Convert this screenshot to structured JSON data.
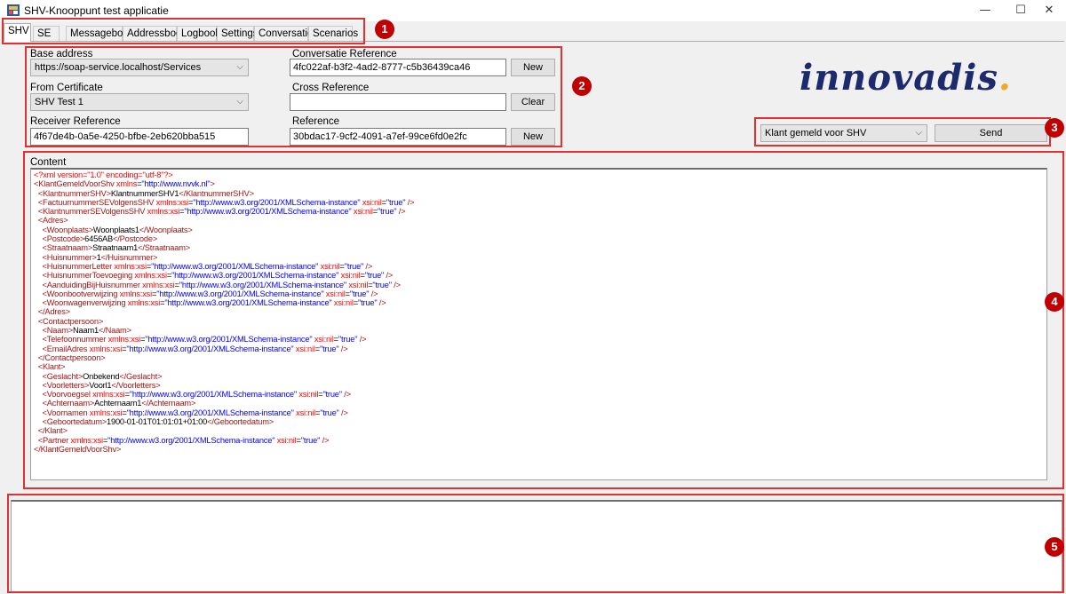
{
  "window": {
    "title": "SHV-Knooppunt test applicatie",
    "minimize": "—",
    "maximize": "☐",
    "close": "✕"
  },
  "tabs": [
    "SHV",
    "SE",
    "Messagebox",
    "Addressbook",
    "Logbook",
    "Settings",
    "Conversation",
    "Scenarios"
  ],
  "form": {
    "base_address_label": "Base address",
    "base_address_value": "https://soap-service.localhost/Services",
    "from_certificate_label": "From Certificate",
    "from_certificate_value": "SHV Test 1",
    "receiver_reference_label": "Receiver Reference",
    "receiver_reference_value": "4f67de4b-0a5e-4250-bfbe-2eb620bba515",
    "conversatie_reference_label": "Conversatie Reference",
    "conversatie_reference_value": "4fc022af-b3f2-4ad2-8777-c5b36439ca46",
    "cross_reference_label": "Cross Reference",
    "cross_reference_value": "",
    "reference_label": "Reference",
    "reference_value": "30bdac17-9cf2-4091-a7ef-99ce6fd0e2fc",
    "new_label": "New",
    "clear_label": "Clear"
  },
  "logo": {
    "text": "innovadis",
    "dot": "."
  },
  "send_panel": {
    "message_type_value": "Klant gemeld voor SHV",
    "send_label": "Send"
  },
  "content": {
    "label": "Content",
    "lines": [
      [
        [
          "a",
          "<?xml version=\"1.0\" encoding=\"utf-8\"?>"
        ]
      ],
      [
        [
          "t",
          "<KlantGemeldVoorShv "
        ],
        [
          "a",
          "xmlns"
        ],
        [
          "x",
          "="
        ],
        [
          "v",
          "\"http://www.nvvk.nl\""
        ],
        [
          "t",
          ">"
        ]
      ],
      [
        [
          "t",
          "  <KlantnummerSHV>"
        ],
        [
          "x",
          "KlantnummerSHV1"
        ],
        [
          "t",
          "</KlantnummerSHV>"
        ]
      ],
      [
        [
          "t",
          "  <FactuurnummerSEVolgensSHV "
        ],
        [
          "a",
          "xmlns:xsi"
        ],
        [
          "x",
          "="
        ],
        [
          "v",
          "\"http://www.w3.org/2001/XMLSchema-instance\""
        ],
        [
          "a",
          " xsi:nil"
        ],
        [
          "x",
          "="
        ],
        [
          "v",
          "\"true\""
        ],
        [
          "t",
          " />"
        ]
      ],
      [
        [
          "t",
          "  <KlantnummerSEVolgensSHV "
        ],
        [
          "a",
          "xmlns:xsi"
        ],
        [
          "x",
          "="
        ],
        [
          "v",
          "\"http://www.w3.org/2001/XMLSchema-instance\""
        ],
        [
          "a",
          " xsi:nil"
        ],
        [
          "x",
          "="
        ],
        [
          "v",
          "\"true\""
        ],
        [
          "t",
          " />"
        ]
      ],
      [
        [
          "t",
          "  <Adres>"
        ]
      ],
      [
        [
          "t",
          "    <Woonplaats>"
        ],
        [
          "x",
          "Woonplaats1"
        ],
        [
          "t",
          "</Woonplaats>"
        ]
      ],
      [
        [
          "t",
          "    <Postcode>"
        ],
        [
          "x",
          "6456AB"
        ],
        [
          "t",
          "</Postcode>"
        ]
      ],
      [
        [
          "t",
          "    <Straatnaam>"
        ],
        [
          "x",
          "Straatnaam1"
        ],
        [
          "t",
          "</Straatnaam>"
        ]
      ],
      [
        [
          "t",
          "    <Huisnummer>"
        ],
        [
          "x",
          "1"
        ],
        [
          "t",
          "</Huisnummer>"
        ]
      ],
      [
        [
          "t",
          "    <HuisnummerLetter "
        ],
        [
          "a",
          "xmlns:xsi"
        ],
        [
          "x",
          "="
        ],
        [
          "v",
          "\"http://www.w3.org/2001/XMLSchema-instance\""
        ],
        [
          "a",
          " xsi:nil"
        ],
        [
          "x",
          "="
        ],
        [
          "v",
          "\"true\""
        ],
        [
          "t",
          " />"
        ]
      ],
      [
        [
          "t",
          "    <HuisnummerToevoeging "
        ],
        [
          "a",
          "xmlns:xsi"
        ],
        [
          "x",
          "="
        ],
        [
          "v",
          "\"http://www.w3.org/2001/XMLSchema-instance\""
        ],
        [
          "a",
          " xsi:nil"
        ],
        [
          "x",
          "="
        ],
        [
          "v",
          "\"true\""
        ],
        [
          "t",
          " />"
        ]
      ],
      [
        [
          "t",
          "    <AanduidingBijHuisnummer "
        ],
        [
          "a",
          "xmlns:xsi"
        ],
        [
          "x",
          "="
        ],
        [
          "v",
          "\"http://www.w3.org/2001/XMLSchema-instance\""
        ],
        [
          "a",
          " xsi:nil"
        ],
        [
          "x",
          "="
        ],
        [
          "v",
          "\"true\""
        ],
        [
          "t",
          " />"
        ]
      ],
      [
        [
          "t",
          "    <Woonbootverwijzing "
        ],
        [
          "a",
          "xmlns:xsi"
        ],
        [
          "x",
          "="
        ],
        [
          "v",
          "\"http://www.w3.org/2001/XMLSchema-instance\""
        ],
        [
          "a",
          " xsi:nil"
        ],
        [
          "x",
          "="
        ],
        [
          "v",
          "\"true\""
        ],
        [
          "t",
          " />"
        ]
      ],
      [
        [
          "t",
          "    <Woonwagenverwijzing "
        ],
        [
          "a",
          "xmlns:xsi"
        ],
        [
          "x",
          "="
        ],
        [
          "v",
          "\"http://www.w3.org/2001/XMLSchema-instance\""
        ],
        [
          "a",
          " xsi:nil"
        ],
        [
          "x",
          "="
        ],
        [
          "v",
          "\"true\""
        ],
        [
          "t",
          " />"
        ]
      ],
      [
        [
          "t",
          "  </Adres>"
        ]
      ],
      [
        [
          "t",
          "  <Contactpersoon>"
        ]
      ],
      [
        [
          "t",
          "    <Naam>"
        ],
        [
          "x",
          "Naam1"
        ],
        [
          "t",
          "</Naam>"
        ]
      ],
      [
        [
          "t",
          "    <Telefoonnummer "
        ],
        [
          "a",
          "xmlns:xsi"
        ],
        [
          "x",
          "="
        ],
        [
          "v",
          "\"http://www.w3.org/2001/XMLSchema-instance\""
        ],
        [
          "a",
          " xsi:nil"
        ],
        [
          "x",
          "="
        ],
        [
          "v",
          "\"true\""
        ],
        [
          "t",
          " />"
        ]
      ],
      [
        [
          "t",
          "    <EmailAdres "
        ],
        [
          "a",
          "xmlns:xsi"
        ],
        [
          "x",
          "="
        ],
        [
          "v",
          "\"http://www.w3.org/2001/XMLSchema-instance\""
        ],
        [
          "a",
          " xsi:nil"
        ],
        [
          "x",
          "="
        ],
        [
          "v",
          "\"true\""
        ],
        [
          "t",
          " />"
        ]
      ],
      [
        [
          "t",
          "  </Contactpersoon>"
        ]
      ],
      [
        [
          "t",
          "  <Klant>"
        ]
      ],
      [
        [
          "t",
          "    <Geslacht>"
        ],
        [
          "x",
          "Onbekend"
        ],
        [
          "t",
          "</Geslacht>"
        ]
      ],
      [
        [
          "t",
          "    <Voorletters>"
        ],
        [
          "x",
          "Voorl1"
        ],
        [
          "t",
          "</Voorletters>"
        ]
      ],
      [
        [
          "t",
          "    <Voorvoegsel "
        ],
        [
          "a",
          "xmlns:xsi"
        ],
        [
          "x",
          "="
        ],
        [
          "v",
          "\"http://www.w3.org/2001/XMLSchema-instance\""
        ],
        [
          "a",
          " xsi:nil"
        ],
        [
          "x",
          "="
        ],
        [
          "v",
          "\"true\""
        ],
        [
          "t",
          " />"
        ]
      ],
      [
        [
          "t",
          "    <Achternaam>"
        ],
        [
          "x",
          "Achternaam1"
        ],
        [
          "t",
          "</Achternaam>"
        ]
      ],
      [
        [
          "t",
          "    <Voornamen "
        ],
        [
          "a",
          "xmlns:xsi"
        ],
        [
          "x",
          "="
        ],
        [
          "v",
          "\"http://www.w3.org/2001/XMLSchema-instance\""
        ],
        [
          "a",
          " xsi:nil"
        ],
        [
          "x",
          "="
        ],
        [
          "v",
          "\"true\""
        ],
        [
          "t",
          " />"
        ]
      ],
      [
        [
          "t",
          "    <Geboortedatum>"
        ],
        [
          "x",
          "1900-01-01T01:01:01+01:00"
        ],
        [
          "t",
          "</Geboortedatum>"
        ]
      ],
      [
        [
          "t",
          "  </Klant>"
        ]
      ],
      [
        [
          "t",
          "  <Partner "
        ],
        [
          "a",
          "xmlns:xsi"
        ],
        [
          "x",
          "="
        ],
        [
          "v",
          "\"http://www.w3.org/2001/XMLSchema-instance\""
        ],
        [
          "a",
          " xsi:nil"
        ],
        [
          "x",
          "="
        ],
        [
          "v",
          "\"true\""
        ],
        [
          "t",
          " />"
        ]
      ],
      [
        [
          "t",
          "</KlantGemeldVoorShv>"
        ]
      ]
    ]
  },
  "output": {
    "text": ""
  },
  "annotations": [
    "1",
    "2",
    "3",
    "4",
    "5"
  ],
  "colors": {
    "annotation_red": "#e03030",
    "marker_fill": "#c00000",
    "logo_blue": "#1e2a6e",
    "logo_dot": "#f5a623"
  }
}
